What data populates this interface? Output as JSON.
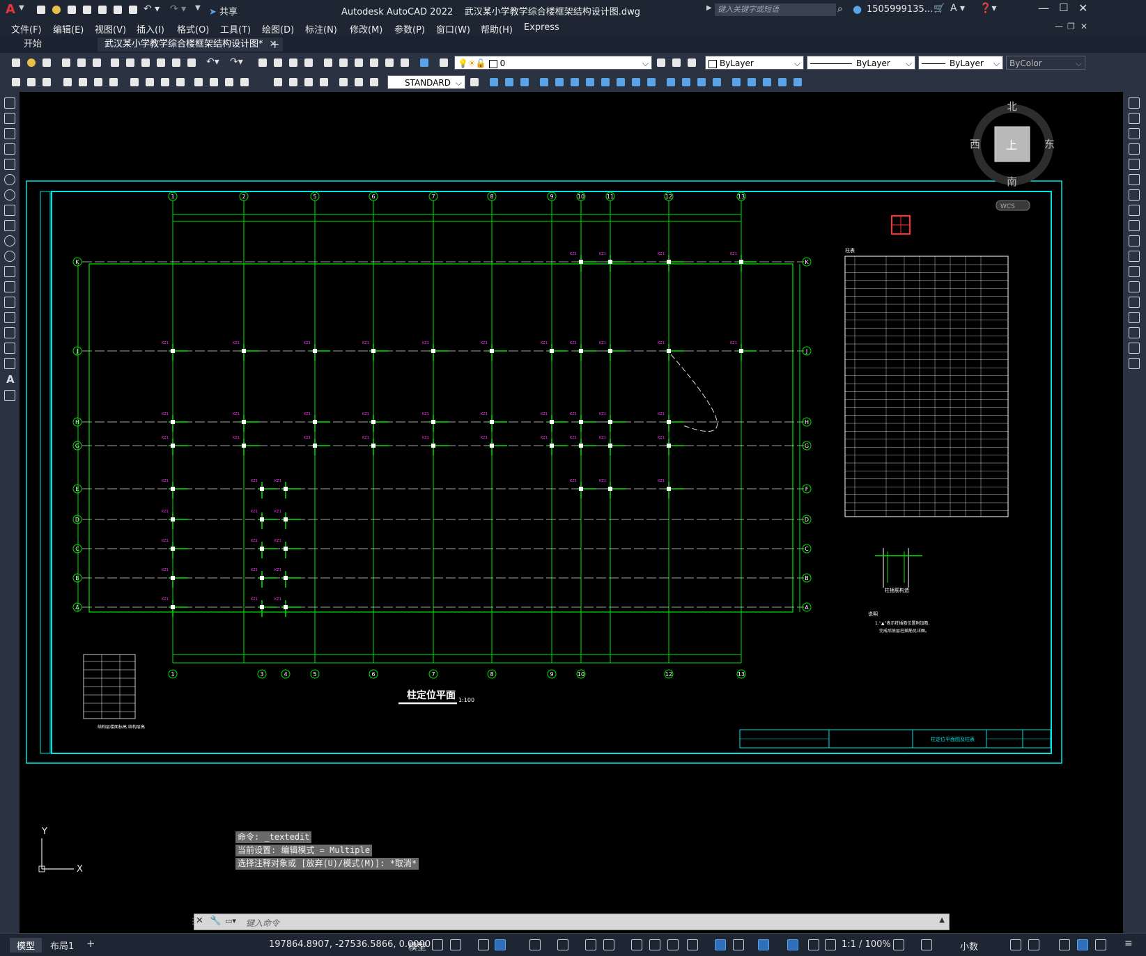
{
  "app": {
    "title": "Autodesk AutoCAD 2022    武汉某小学教学综合楼框架结构设计图.dwg",
    "search_placeholder": "键入关键字或短语",
    "user": "1505999135...",
    "share": "共享"
  },
  "menu": [
    "文件(F)",
    "编辑(E)",
    "视图(V)",
    "插入(I)",
    "格式(O)",
    "工具(T)",
    "绘图(D)",
    "标注(N)",
    "修改(M)",
    "参数(P)",
    "窗口(W)",
    "帮助(H)",
    "Express"
  ],
  "tabs": {
    "start": "开始",
    "doc": "武汉某小学教学综合楼框架结构设计图*"
  },
  "toolbar": {
    "layer": "0",
    "linestyle": "STANDARD",
    "color": "ByLayer",
    "linetype": "ByLayer",
    "lineweight": "ByLayer",
    "plotstyle": "ByColor"
  },
  "viewcube": {
    "north": "北",
    "south": "南",
    "east": "东",
    "west": "西",
    "top": "上",
    "wcs": "WCS"
  },
  "drawing": {
    "plan_title": "柱定位平面",
    "scale": "1:100",
    "grid_top": [
      "1",
      "2",
      "5",
      "6",
      "7",
      "8",
      "9",
      "10",
      "11",
      "12",
      "13"
    ],
    "grid_bottom": [
      "1",
      "3",
      "4",
      "5",
      "6",
      "7",
      "8",
      "9",
      "10",
      "12",
      "13"
    ],
    "grid_rows": [
      "K",
      "J",
      "H",
      "G",
      "E",
      "D",
      "C",
      "B",
      "A"
    ],
    "grid_right_rows": [
      "K",
      "J",
      "H",
      "G",
      "F",
      "D",
      "C",
      "B",
      "A"
    ],
    "col_label": "KZ1",
    "table_title": "柱表",
    "notes_title": "说明",
    "notes": [
      "1.“▲”表示柱插筋位置附加筋,",
      "完成后底层柱插筋见详图。"
    ],
    "titleblock_name": "柱定位平面图及柱表",
    "section_label": "柱插筋构造",
    "level_table_caption": "结构层楼面标高\n结构层高"
  },
  "command": {
    "history": [
      "命令: _textedit",
      "当前设置: 编辑模式 = Multiple",
      "选择注释对象或 [放弃(U)/模式(M)]: *取消*"
    ],
    "placeholder": "键入命令"
  },
  "status": {
    "model_tab": "模型",
    "layout_tab": "布局1",
    "coords": "197864.8907, -27536.5866, 0.0000",
    "mode": "模型",
    "scale": "1:1 / 100%",
    "units": "小数"
  },
  "ucs": {
    "x": "X",
    "y": "Y"
  }
}
